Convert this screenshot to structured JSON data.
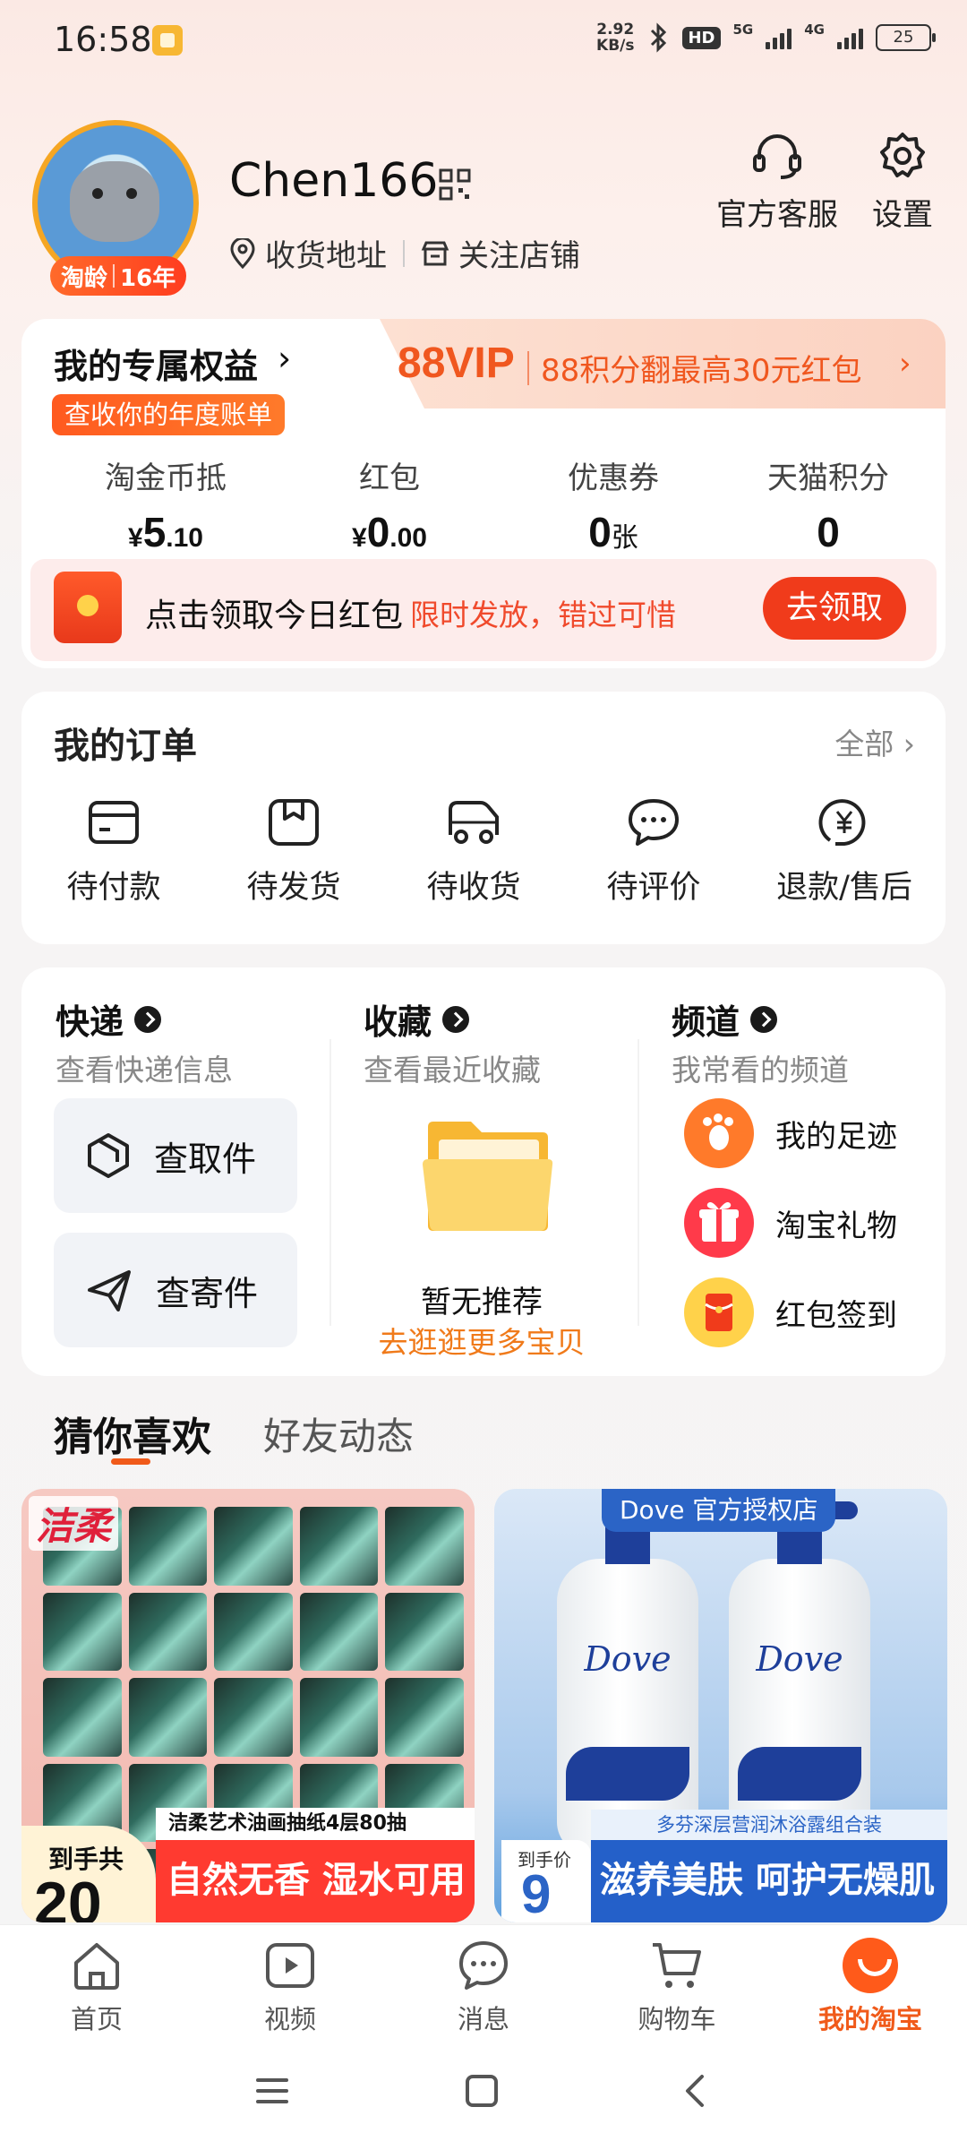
{
  "status": {
    "time": "16:58",
    "net_speed_value": "2.92",
    "net_speed_unit": "KB/s",
    "hd_label": "HD",
    "sig1_label": "5G",
    "sig2_label": "4G",
    "battery": "25"
  },
  "profile": {
    "username": "Chen166",
    "badge_text": "淘龄",
    "badge_years": "16年",
    "address_link": "收货地址",
    "follow_link": "关注店铺",
    "service_label": "官方客服",
    "settings_label": "设置"
  },
  "benefits": {
    "title": "我的专属权益",
    "bill_tag": "查收你的年度账单",
    "vip_title": "88VIP",
    "vip_text": "88积分翻最高30元红包",
    "stats": [
      {
        "label": "淘金币抵",
        "currency": "¥",
        "main": "5",
        "decimal": ".10",
        "unit": ""
      },
      {
        "label": "红包",
        "currency": "¥",
        "main": "0",
        "decimal": ".00",
        "unit": ""
      },
      {
        "label": "优惠券",
        "currency": "",
        "main": "0",
        "decimal": "",
        "unit": "张"
      },
      {
        "label": "天猫积分",
        "currency": "",
        "main": "0",
        "decimal": "",
        "unit": ""
      }
    ],
    "redpack_text": "点击领取今日红包",
    "redpack_sub": "限时发放，错过可惜",
    "redpack_button": "去领取"
  },
  "orders": {
    "title": "我的订单",
    "all_label": "全部",
    "items": [
      {
        "label": "待付款",
        "icon": "wallet-icon"
      },
      {
        "label": "待发货",
        "icon": "package-icon"
      },
      {
        "label": "待收货",
        "icon": "truck-icon"
      },
      {
        "label": "待评价",
        "icon": "comment-icon"
      },
      {
        "label": "退款/售后",
        "icon": "refund-icon"
      }
    ]
  },
  "tri": {
    "express_title": "快递",
    "express_sub": "查看快递信息",
    "pickup_label": "查取件",
    "send_label": "查寄件",
    "fav_title": "收藏",
    "fav_sub": "查看最近收藏",
    "fav_empty": "暂无推荐",
    "fav_link": "去逛逛更多宝贝",
    "channel_title": "频道",
    "channel_sub": "我常看的频道",
    "channels": [
      {
        "label": "我的足迹",
        "icon": "footprint-icon",
        "color": "#ff7a2a"
      },
      {
        "label": "淘宝礼物",
        "icon": "gift-icon",
        "color": "#ff3a4a"
      },
      {
        "label": "红包签到",
        "icon": "red-envelope-icon",
        "color": "#ffd24a"
      }
    ]
  },
  "feed": {
    "tab_active": "猜你喜欢",
    "tab_other": "好友动态",
    "left": {
      "brand": "洁柔",
      "price_prefix": "到手共",
      "price_main": "20",
      "sub_title": "洁柔艺术油画抽纸4层80抽",
      "promo": "自然无香 湿水可用"
    },
    "right": {
      "store_tag": "Dove 官方授权店",
      "bottle_brand": "Dove",
      "price_prefix": "到手价",
      "price_main": "9",
      "sub_title": "多芬深层营润沐浴露组合装",
      "promo": "滋养美肤 呵护无燥肌"
    }
  },
  "nav": [
    {
      "label": "首页",
      "icon": "home-icon"
    },
    {
      "label": "视频",
      "icon": "video-icon"
    },
    {
      "label": "消息",
      "icon": "message-icon"
    },
    {
      "label": "购物车",
      "icon": "cart-icon"
    },
    {
      "label": "我的淘宝",
      "icon": "taobao-face-icon"
    }
  ],
  "colors": {
    "accent": "#f05a1a",
    "red": "#f03b1b",
    "vip": "#f0571f"
  }
}
